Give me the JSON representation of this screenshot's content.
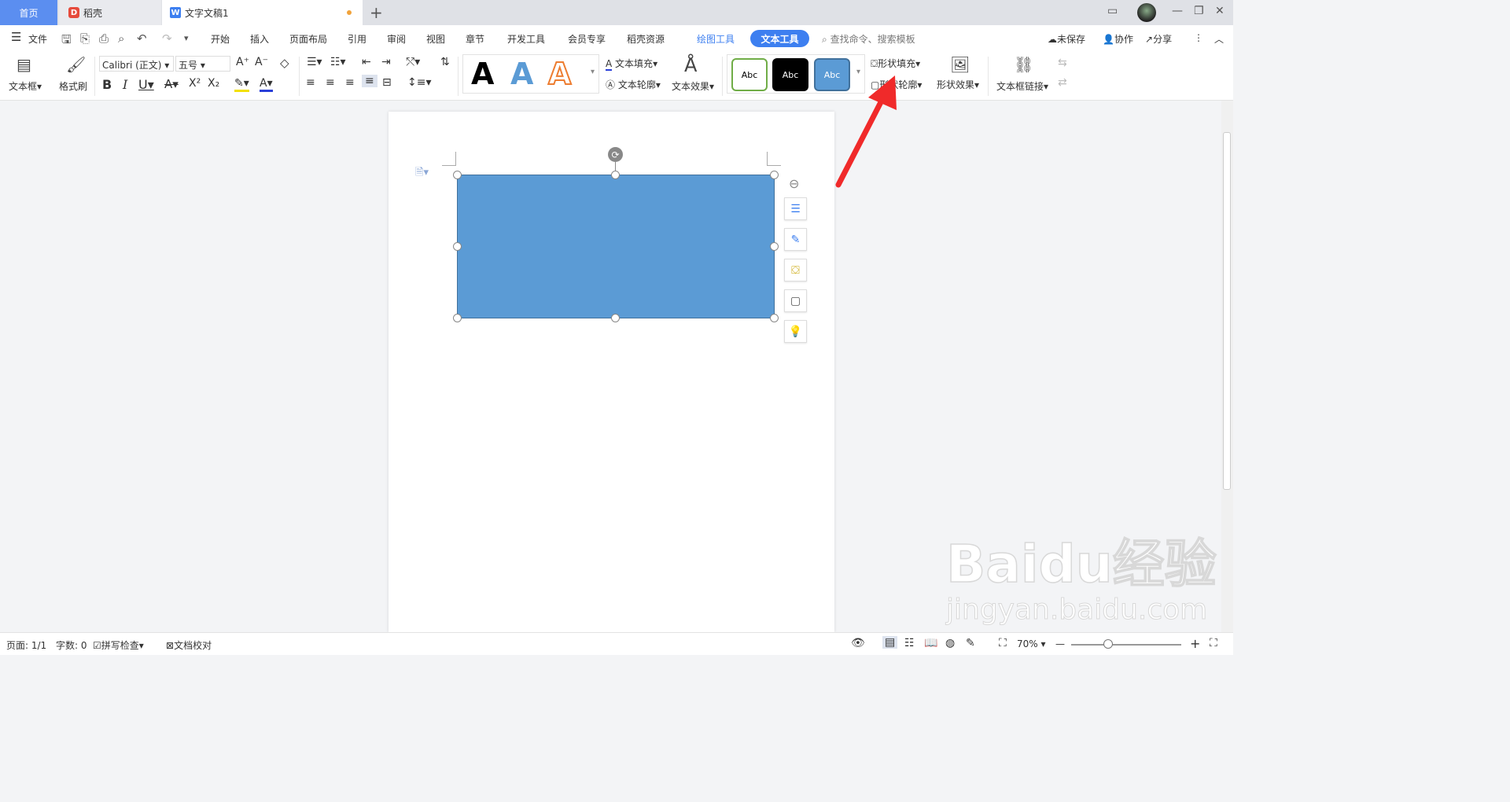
{
  "tabs": {
    "home": "首页",
    "daoke": "稻壳",
    "doc": "文字文稿1"
  },
  "menu": {
    "file": "文件",
    "items": [
      "开始",
      "插入",
      "页面布局",
      "引用",
      "审阅",
      "视图",
      "章节",
      "开发工具",
      "会员专享",
      "稻壳资源"
    ],
    "drawing_tools": "绘图工具",
    "text_tools": "文本工具",
    "search": "查找命令、搜索模板",
    "unsaved": "未保存",
    "collab": "协作",
    "share": "分享"
  },
  "ribbon": {
    "textbox": "文本框",
    "format_painter": "格式刷",
    "font": "Calibri (正文)",
    "size": "五号",
    "text_fill": "文本填充",
    "text_outline": "文本轮廓",
    "text_effect": "文本效果",
    "style_abc": "Abc",
    "shape_fill": "形状填充",
    "shape_outline": "形状轮廓",
    "shape_effect": "形状效果",
    "textbox_link": "文本框链接"
  },
  "status": {
    "page": "页面: 1/1",
    "words": "字数: 0",
    "spell": "拼写检查",
    "proof": "文档校对",
    "zoom": "70%"
  },
  "colors": {
    "accent": "#3d7ff0",
    "shape_fill": "#5b9bd5",
    "arrow": "#f02a2a"
  },
  "watermark": {
    "logo": "Baidu经验",
    "url": "jingyan.baidu.com"
  }
}
